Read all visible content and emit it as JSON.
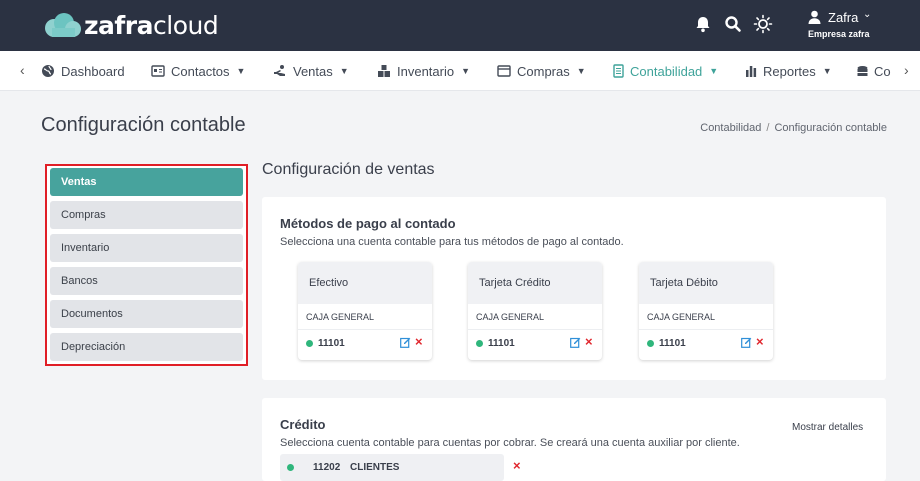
{
  "header": {
    "logo_bold": "zafra",
    "logo_light": "cloud",
    "user_name": "Zafra",
    "company": "Empresa zafra",
    "icons": [
      "bell-icon",
      "search-icon",
      "sun-icon",
      "user-icon"
    ]
  },
  "nav": {
    "items": [
      {
        "label": "Dashboard",
        "icon": "globe-icon"
      },
      {
        "label": "Contactos",
        "icon": "contacts-icon"
      },
      {
        "label": "Ventas",
        "icon": "hand-icon"
      },
      {
        "label": "Inventario",
        "icon": "boxes-icon"
      },
      {
        "label": "Compras",
        "icon": "cart-icon"
      },
      {
        "label": "Contabilidad",
        "icon": "ledger-icon"
      },
      {
        "label": "Reportes",
        "icon": "chart-icon"
      },
      {
        "label": "Co",
        "icon": "coins-icon"
      }
    ],
    "active": "Contabilidad"
  },
  "page": {
    "title": "Configuración contable",
    "breadcrumb": [
      "Contabilidad",
      "Configuración contable"
    ]
  },
  "sidebar": {
    "items": [
      "Ventas",
      "Compras",
      "Inventario",
      "Bancos",
      "Documentos",
      "Depreciación"
    ],
    "active": "Ventas"
  },
  "main": {
    "section_title": "Configuración de ventas",
    "cash": {
      "title": "Métodos de pago al contado",
      "description": "Selecciona una cuenta contable para tus métodos de pago al contado.",
      "methods": [
        {
          "name": "Efectivo",
          "account_name": "CAJA GENERAL",
          "account_code": "11101"
        },
        {
          "name": "Tarjeta Crédito",
          "account_name": "CAJA GENERAL",
          "account_code": "11101"
        },
        {
          "name": "Tarjeta Débito",
          "account_name": "CAJA GENERAL",
          "account_code": "11101"
        }
      ]
    },
    "credit": {
      "title": "Crédito",
      "description": "Selecciona cuenta contable para cuentas por cobrar. Se creará una cuenta auxiliar por cliente.",
      "show_details": "Mostrar detalles",
      "account_code": "11202",
      "account_name": "CLIENTES"
    }
  },
  "colors": {
    "topbar": "#2b3242",
    "accent": "#47a39d",
    "status_dot": "#2fb67c",
    "delete": "#e0262d",
    "highlight_border": "#e01e26"
  }
}
